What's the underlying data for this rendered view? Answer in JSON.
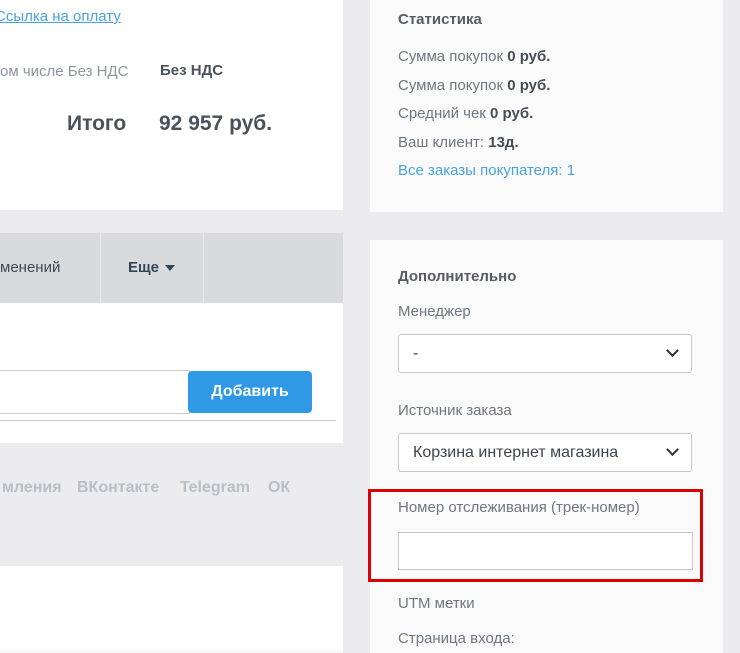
{
  "colors": {
    "page_bg": "#ececee",
    "panel_bg": "#fafafa",
    "toolbar_gray": "#d9dadc",
    "accent_blue": "#2f99e5",
    "link_blue": "#47a3e0",
    "highlight_red": "#dc0000",
    "muted_tab_text": "#b9bfc6"
  },
  "left": {
    "payment_card": {
      "payment_link": "Ссылка на оплату",
      "vat_row_label": "ом числе Без НДС",
      "vat_row_value": "Без НДС",
      "total_label": "Итого",
      "total_value": "92 957 руб."
    },
    "toolbar": {
      "history_label": "менений",
      "more_label": "Еще"
    },
    "comment_form": {
      "input_value": "",
      "add_button": "Добавить"
    },
    "channel_tabs": [
      {
        "label": "мления"
      },
      {
        "label": "ВКонтакте"
      },
      {
        "label": "Telegram"
      },
      {
        "label": "ОК"
      }
    ]
  },
  "stats": {
    "title": "Статистика",
    "rows": [
      {
        "label": "Сумма покупок ",
        "value": "0 руб."
      },
      {
        "label": "Сумма покупок ",
        "value": "0 руб."
      },
      {
        "label": "Средний чек ",
        "value": "0 руб."
      },
      {
        "label": "Ваш клиент: ",
        "value": "13д."
      }
    ],
    "all_orders_link": "Все заказы покупателя: 1"
  },
  "additional": {
    "title": "Дополнительно",
    "manager_label": "Менеджер",
    "manager_value": "-",
    "source_label": "Источник заказа",
    "source_value": "Корзина интернет магазина",
    "tracking_label": "Номер отслеживания (трек-номер)",
    "tracking_value": "",
    "utm_label": "UTM метки",
    "entry_page_label": "Страница входа:"
  }
}
